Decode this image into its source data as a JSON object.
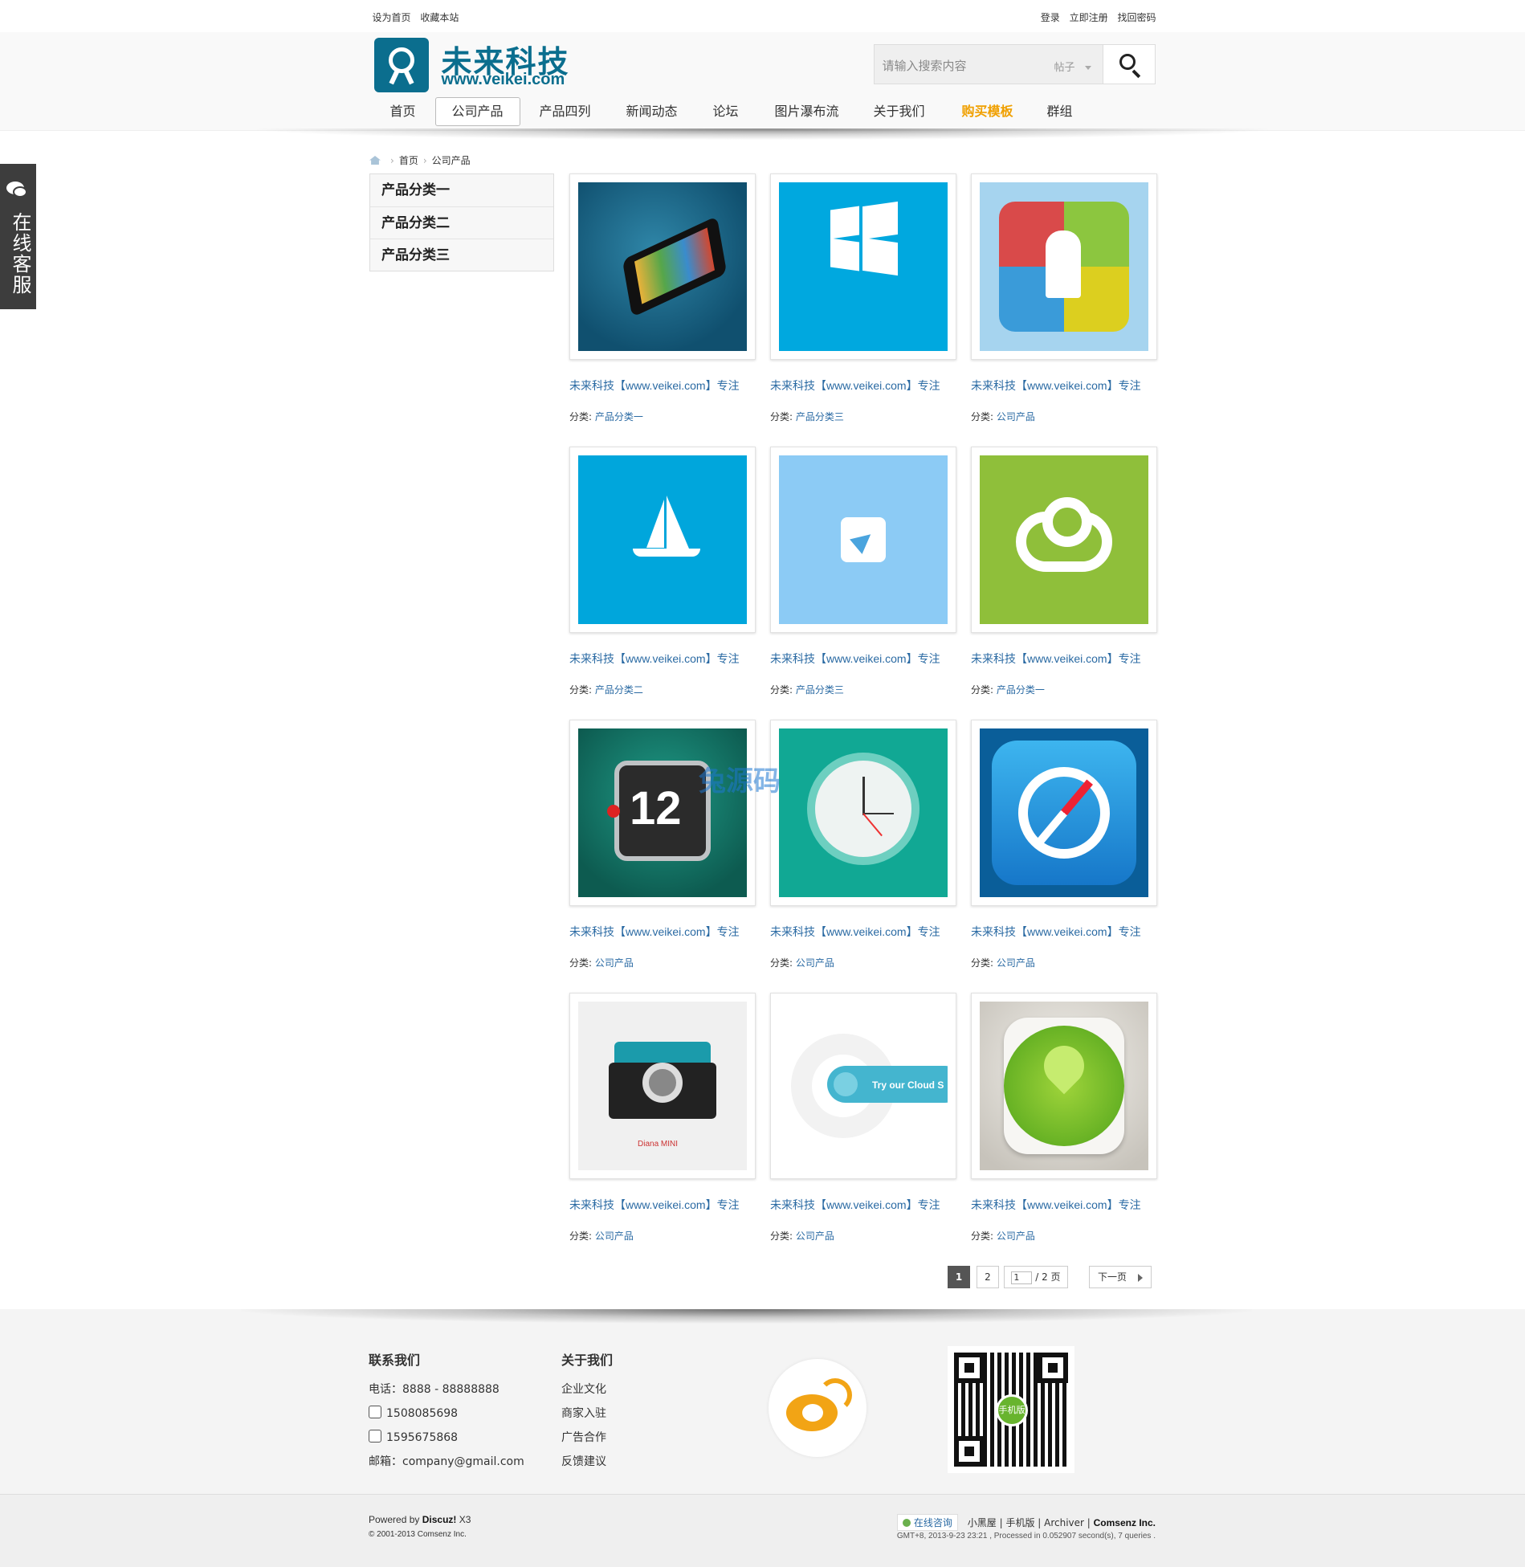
{
  "topbar": {
    "left": [
      "设为首页",
      "收藏本站"
    ],
    "right": [
      "登录",
      "立即注册",
      "找回密码"
    ]
  },
  "brand": {
    "name_cn": "未来科技",
    "domain": "www.veikei.com"
  },
  "search": {
    "placeholder": "请输入搜索内容",
    "type": "帖子"
  },
  "nav": [
    {
      "label": "首页"
    },
    {
      "label": "公司产品",
      "active": true
    },
    {
      "label": "产品四列"
    },
    {
      "label": "新闻动态"
    },
    {
      "label": "论坛"
    },
    {
      "label": "图片瀑布流"
    },
    {
      "label": "关于我们"
    },
    {
      "label": "购买模板"
    },
    {
      "label": "群组"
    }
  ],
  "sidetab": {
    "label": "在线客服"
  },
  "breadcrumb": [
    "首页",
    "公司产品"
  ],
  "categories": [
    "产品分类一",
    "产品分类二",
    "产品分类三"
  ],
  "cat_prefix": "分类:",
  "products": [
    {
      "title": "未来科技【www.veikei.com】专注",
      "category": "产品分类一",
      "icon": "phone-icon"
    },
    {
      "title": "未来科技【www.veikei.com】专注",
      "category": "产品分类三",
      "icon": "windows-logo-icon"
    },
    {
      "title": "未来科技【www.veikei.com】专注",
      "category": "公司产品",
      "icon": "chess-knight-icon"
    },
    {
      "title": "未来科技【www.veikei.com】专注",
      "category": "产品分类二",
      "icon": "sailboat-icon"
    },
    {
      "title": "未来科技【www.veikei.com】专注",
      "category": "产品分类三",
      "icon": "paper-plane-icon"
    },
    {
      "title": "未来科技【www.veikei.com】专注",
      "category": "产品分类一",
      "icon": "cloud-icon"
    },
    {
      "title": "未来科技【www.veikei.com】专注",
      "category": "公司产品",
      "icon": "flip-calendar-icon",
      "label": "12"
    },
    {
      "title": "未来科技【www.veikei.com】专注",
      "category": "公司产品",
      "icon": "clock-icon"
    },
    {
      "title": "未来科技【www.veikei.com】专注",
      "category": "公司产品",
      "icon": "compass-icon"
    },
    {
      "title": "未来科技【www.veikei.com】专注",
      "category": "公司产品",
      "icon": "camera-icon",
      "label": "Diana MINI"
    },
    {
      "title": "未来科技【www.veikei.com】专注",
      "category": "公司产品",
      "icon": "cloud-button-icon",
      "label": "Try our Cloud S"
    },
    {
      "title": "未来科技【www.veikei.com】专注",
      "category": "公司产品",
      "icon": "map-pin-icon"
    }
  ],
  "watermark": "兔源码",
  "pager": {
    "current": "1",
    "second": "2",
    "input": "1",
    "total": "/ 2 页",
    "next": "下一页"
  },
  "footer": {
    "contact_title": "联系我们",
    "phone": "电话：8888 - 88888888",
    "qq1": "1508085698",
    "qq2": "1595675868",
    "email": "邮箱：company@gmail.com",
    "about_title": "关于我们",
    "about_links": [
      "企业文化",
      "商家入驻",
      "广告合作",
      "反馈建议"
    ],
    "qr_badge": "手机版"
  },
  "bottom": {
    "powered_prefix": "Powered by",
    "powered_brand": "Discuz!",
    "powered_ver": "X3",
    "copyright": "© 2001-2013 Comsenz Inc.",
    "online": "在线咨询",
    "links": [
      "小黑屋",
      "手机版",
      "Archiver"
    ],
    "company": "Comsenz Inc.",
    "gmt": "GMT+8, 2013-9-23 23:21 , Processed in 0.052907 second(s), 7 queries ."
  },
  "colors": {
    "brand": "#0b6e8e",
    "link": "#2a6aa3",
    "buy": "#f0a000",
    "sidetab": "#3d3d3d"
  }
}
